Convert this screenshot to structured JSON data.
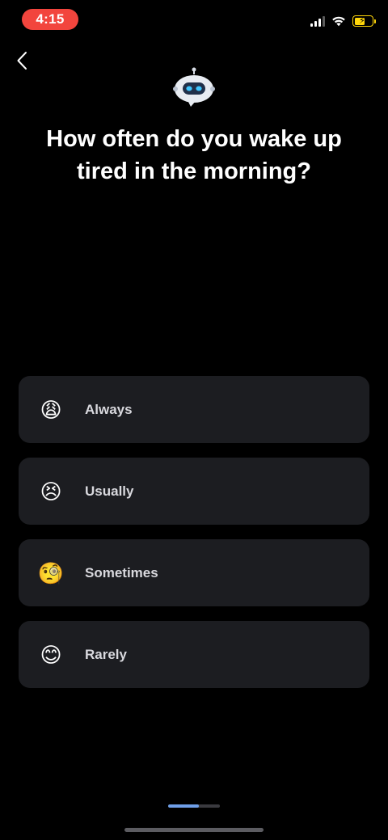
{
  "status_bar": {
    "time": "4:15",
    "signal_icon": "cellular-signal-icon",
    "wifi_icon": "wifi-icon",
    "battery_icon": "battery-charging-icon",
    "time_pill_color": "#f2453d",
    "battery_color": "#ffd60a"
  },
  "header": {
    "back_icon": "chevron-left-icon",
    "mascot_icon": "robot-chat-icon"
  },
  "question": {
    "title": "How often do you wake up\ntired in the morning?"
  },
  "options": [
    {
      "emoji": "😩",
      "icon": "weary-face-icon",
      "label": "Always"
    },
    {
      "emoji": "😣",
      "icon": "persevering-face-icon",
      "label": "Usually"
    },
    {
      "emoji": "🧐",
      "icon": "monocle-face-icon",
      "label": "Sometimes"
    },
    {
      "emoji": "😊",
      "icon": "smiling-face-icon",
      "label": "Rarely"
    }
  ],
  "progress": {
    "fraction": 0.6,
    "color": "#6f9fe8"
  }
}
